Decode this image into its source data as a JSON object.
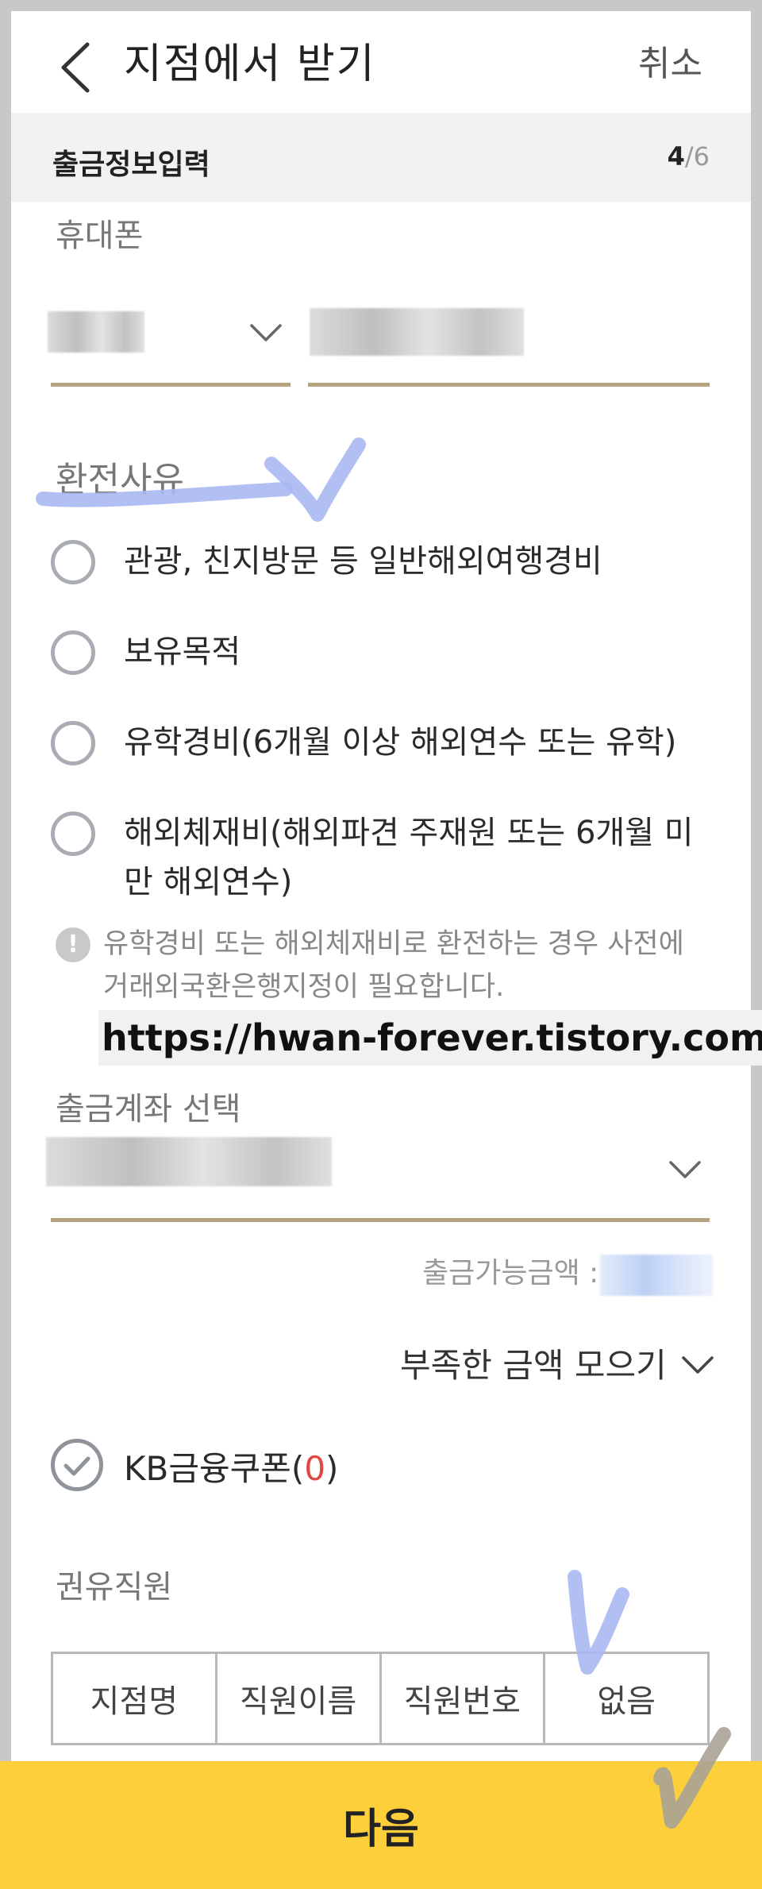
{
  "header": {
    "title": "지점에서 받기",
    "cancel_label": "취소"
  },
  "step": {
    "title": "출금정보입력",
    "current": "4",
    "separator": "/",
    "total": "6"
  },
  "phone": {
    "label": "휴대폰"
  },
  "reason": {
    "label": "환전사유",
    "options": [
      {
        "label": "관광, 친지방문 등 일반해외여행경비"
      },
      {
        "label": "보유목적"
      },
      {
        "label": "유학경비(6개월 이상 해외연수 또는 유학)"
      },
      {
        "label_line1": "해외체재비(해외파견 주재원 또는 6개월 미",
        "label_line2": "만 해외연수)"
      }
    ]
  },
  "notice": {
    "icon": "!",
    "line1": "유학경비 또는 해외체재비로 환전하는 경우 사전에",
    "line2": "거래외국환은행지정이 필요합니다."
  },
  "watermark": "https://hwan-forever.tistory.com/",
  "account": {
    "label": "출금계좌 선택"
  },
  "available": {
    "label": "출금가능금액 :"
  },
  "collect": {
    "label": "부족한 금액 모으기"
  },
  "coupon": {
    "prefix": "KB금융쿠폰(",
    "count": "0",
    "suffix": ")"
  },
  "staff": {
    "label": "권유직원",
    "options": [
      "지점명",
      "직원이름",
      "직원번호",
      "없음"
    ]
  },
  "next_button": "다음",
  "colors": {
    "accent_yellow": "#fdcf3a",
    "underline_gold": "#b5a27e",
    "annotation_blue": "#a9b8f2",
    "annotation_gray": "#a8a296"
  }
}
